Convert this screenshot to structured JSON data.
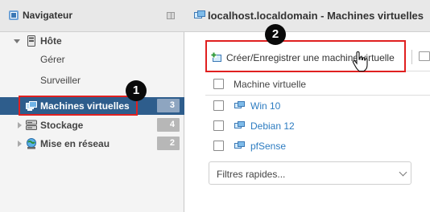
{
  "navigator": {
    "title": "Navigateur",
    "host": {
      "label": "Hôte",
      "items": [
        {
          "label": "Gérer"
        },
        {
          "label": "Surveiller"
        }
      ]
    },
    "sections": [
      {
        "label": "Machines virtuelles",
        "count": "3",
        "icon": "vm-icon",
        "active": true
      },
      {
        "label": "Stockage",
        "count": "4",
        "icon": "storage-icon",
        "active": false
      },
      {
        "label": "Mise en réseau",
        "count": "2",
        "icon": "network-icon",
        "active": false
      }
    ]
  },
  "main": {
    "title": "localhost.localdomain - Machines virtuelles",
    "toolbar": {
      "create_label": "Créer/Enregistrer une machine virtuelle"
    },
    "table": {
      "column_header": "Machine virtuelle",
      "rows": [
        {
          "name": "Win 10"
        },
        {
          "name": "Debian 12"
        },
        {
          "name": "pfSense"
        }
      ]
    },
    "filter": {
      "label": "Filtres rapides..."
    }
  },
  "annotations": {
    "marker_1": "1",
    "marker_2": "2",
    "highlight_color": "#e02020"
  },
  "colors": {
    "active_row": "#2e5d8c",
    "link": "#2d7cc1",
    "badge": "#b7b7b7"
  }
}
